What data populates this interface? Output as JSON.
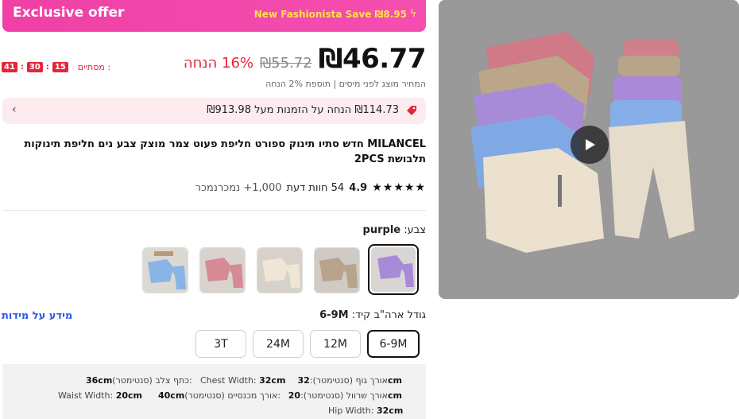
{
  "banner": {
    "title": "Exclusive offer",
    "save_text": "New Fashionista Save ₪8.95",
    "bolt_icon": "lightning-icon"
  },
  "timer": {
    "label": "מסתיים :",
    "hours": "15",
    "minutes": "30",
    "seconds": "41",
    "sep": ":"
  },
  "price": {
    "current": "₪46.77",
    "original": "₪55.72",
    "discount": "16% הנחה",
    "tax_note": "המחיר מוצג לפני מיסים | תוספת 2% הנחה"
  },
  "promo": {
    "text": "₪114.73 הנחה על הזמנות מעל ₪913.98",
    "icon": "tag-icon",
    "chevron": "chevron-left-icon"
  },
  "product": {
    "title": "MILANCEL חדש סתיו תינוק ספורט חליפת פעוט צמר מוצק צבע נים חליפת תינוקות תלבושת 2PCS"
  },
  "rating": {
    "value": "4.9",
    "stars": "★★★★★",
    "reviews": "54 חוות דעת",
    "sold": "1,000+ נמכרנמכר"
  },
  "color": {
    "label": "צבע:",
    "selected": "purple"
  },
  "size": {
    "label": "גודל ארה\"ב קיד:",
    "selected": "6-9M",
    "guide": "מידע על מידות",
    "options": [
      "6-9M",
      "12M",
      "24M",
      "3T"
    ]
  },
  "measurements": {
    "body_length": "אורך גוף (סנטימטר):",
    "body_length_val": "32cm",
    "chest": "Chest Width:",
    "chest_val": "32cm",
    "shoulder": "כתף צלב (סנטימטר):",
    "shoulder_val": "36cm",
    "sleeve": "אורך שרוול (סנטימטר):",
    "sleeve_val": "20cm",
    "pants": "אורך מכנסיים (סנטימטר):",
    "pants_val": "40cm",
    "waist": "Waist Width:",
    "waist_val": "20cm",
    "hip": "Hip Width:",
    "hip_val": "32cm"
  },
  "colors": {
    "accent_pink": "#f03fa6",
    "sale_red": "#e4263a",
    "link_blue": "#2e5be0"
  }
}
